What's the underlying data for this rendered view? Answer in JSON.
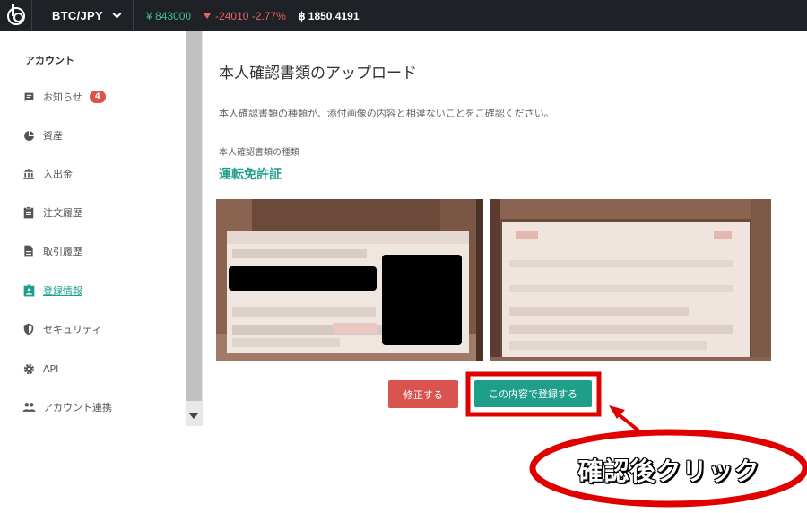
{
  "topbar": {
    "pair": "BTC/JPY",
    "price": "¥ 843000",
    "change": "-24010 -2.77%",
    "btc_balance": "฿ 1850.4191"
  },
  "sidebar": {
    "heading": "アカウント",
    "items": [
      {
        "label": "お知らせ",
        "icon": "message-icon",
        "badge": "4"
      },
      {
        "label": "資産",
        "icon": "pie-chart-icon"
      },
      {
        "label": "入出金",
        "icon": "bank-icon"
      },
      {
        "label": "注文履歴",
        "icon": "clipboard-icon"
      },
      {
        "label": "取引履歴",
        "icon": "document-icon"
      },
      {
        "label": "登録情報",
        "icon": "id-card-icon",
        "active": true
      },
      {
        "label": "セキュリティ",
        "icon": "shield-icon"
      },
      {
        "label": "API",
        "icon": "gear-icon"
      },
      {
        "label": "アカウント連携",
        "icon": "people-icon"
      }
    ]
  },
  "main": {
    "title": "本人確認書類のアップロード",
    "description": "本人確認書類の種類が、添付画像の内容と相違ないことをご確認ください。",
    "doc_type_label": "本人確認書類の種類",
    "doc_type_value": "運転免許証",
    "edit_button": "修正する",
    "submit_button": "この内容で登録する"
  },
  "annotation": {
    "text": "確認後クリック"
  },
  "colors": {
    "accent": "#1f9e8c",
    "danger": "#d9534f",
    "highlight": "#e00000",
    "topbar": "#1e2126"
  }
}
